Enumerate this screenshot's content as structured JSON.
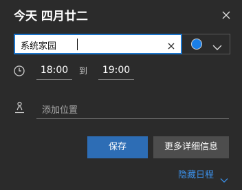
{
  "header": {
    "title": "今天 四月廿二",
    "close_icon": "close-icon"
  },
  "event": {
    "title_value": "系统家园",
    "clear_icon": "clear-icon",
    "color": "#1b7fe6",
    "color_dropdown_icon": "chevron-down-icon"
  },
  "time": {
    "clock_icon": "clock-icon",
    "start": "18:00",
    "to_label": "到",
    "end": "19:00"
  },
  "location": {
    "icon": "location-person-icon",
    "placeholder": "添加位置"
  },
  "actions": {
    "save_label": "保存",
    "more_details_label": "更多详细信息"
  },
  "footer": {
    "hide_schedule_label": "隐藏日程",
    "hide_chevron_icon": "chevron-down-icon"
  },
  "colors": {
    "background": "#2b2b2b",
    "accent": "#2d6db5",
    "link": "#3b8ee5"
  }
}
